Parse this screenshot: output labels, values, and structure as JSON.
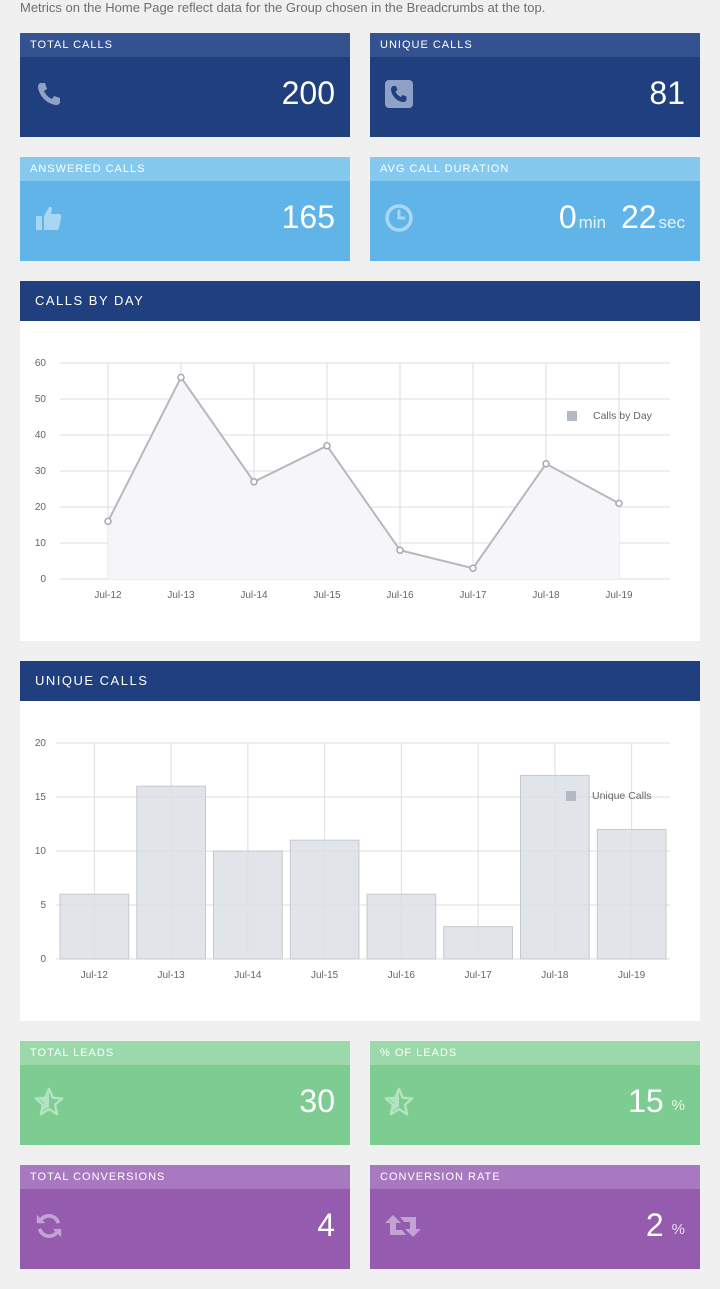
{
  "intro_text": "Metrics on the Home Page reflect data for the Group chosen in the Breadcrumbs at the top.",
  "tiles": {
    "total_calls": {
      "label": "TOTAL CALLS",
      "value": "200",
      "icon": "phone-icon",
      "color": "#203f7e"
    },
    "unique_calls": {
      "label": "UNIQUE CALLS",
      "value": "81",
      "icon": "phone-square-icon",
      "color": "#203f7e"
    },
    "answered_calls": {
      "label": "ANSWERED CALLS",
      "value": "165",
      "icon": "thumbs-up-icon",
      "color": "#61b4e7"
    },
    "avg_call_duration": {
      "label": "AVG CALL DURATION",
      "minutes": "0",
      "min_unit": "min",
      "seconds": "22",
      "sec_unit": "sec",
      "icon": "clock-icon",
      "color": "#61b4e7"
    },
    "total_leads": {
      "label": "TOTAL LEADS",
      "value": "30",
      "icon": "star-icon",
      "color": "#7dcd92"
    },
    "pct_leads": {
      "label": "% OF LEADS",
      "value": "15",
      "unit": "%",
      "icon": "star-icon",
      "color": "#7dcd92"
    },
    "total_conversions": {
      "label": "TOTAL CONVERSIONS",
      "value": "4",
      "icon": "refresh-icon",
      "color": "#945bae"
    },
    "conversion_rate": {
      "label": "CONVERSION RATE",
      "value": "2",
      "unit": "%",
      "icon": "retweet-icon",
      "color": "#945bae"
    }
  },
  "panels": {
    "calls_by_day": {
      "title": "CALLS BY DAY"
    },
    "unique_calls": {
      "title": "UNIQUE CALLS"
    }
  },
  "chart_data": [
    {
      "type": "line",
      "title": "CALLS BY DAY",
      "categories": [
        "Jul-12",
        "Jul-13",
        "Jul-14",
        "Jul-15",
        "Jul-16",
        "Jul-17",
        "Jul-18",
        "Jul-19"
      ],
      "series": [
        {
          "name": "Calls by Day",
          "values": [
            16,
            56,
            27,
            37,
            8,
            3,
            32,
            21
          ]
        }
      ],
      "ylim": [
        0,
        60
      ],
      "yticks": [
        0,
        10,
        20,
        30,
        40,
        50,
        60
      ],
      "grid": true,
      "legend": "top-right"
    },
    {
      "type": "bar",
      "title": "UNIQUE CALLS",
      "categories": [
        "Jul-12",
        "Jul-13",
        "Jul-14",
        "Jul-15",
        "Jul-16",
        "Jul-17",
        "Jul-18",
        "Jul-19"
      ],
      "series": [
        {
          "name": "Unique Calls",
          "values": [
            6,
            16,
            10,
            11,
            6,
            3,
            17,
            12
          ]
        }
      ],
      "ylim": [
        0,
        20
      ],
      "yticks": [
        0,
        5,
        10,
        15,
        20
      ],
      "grid": true,
      "legend": "top-right"
    }
  ]
}
